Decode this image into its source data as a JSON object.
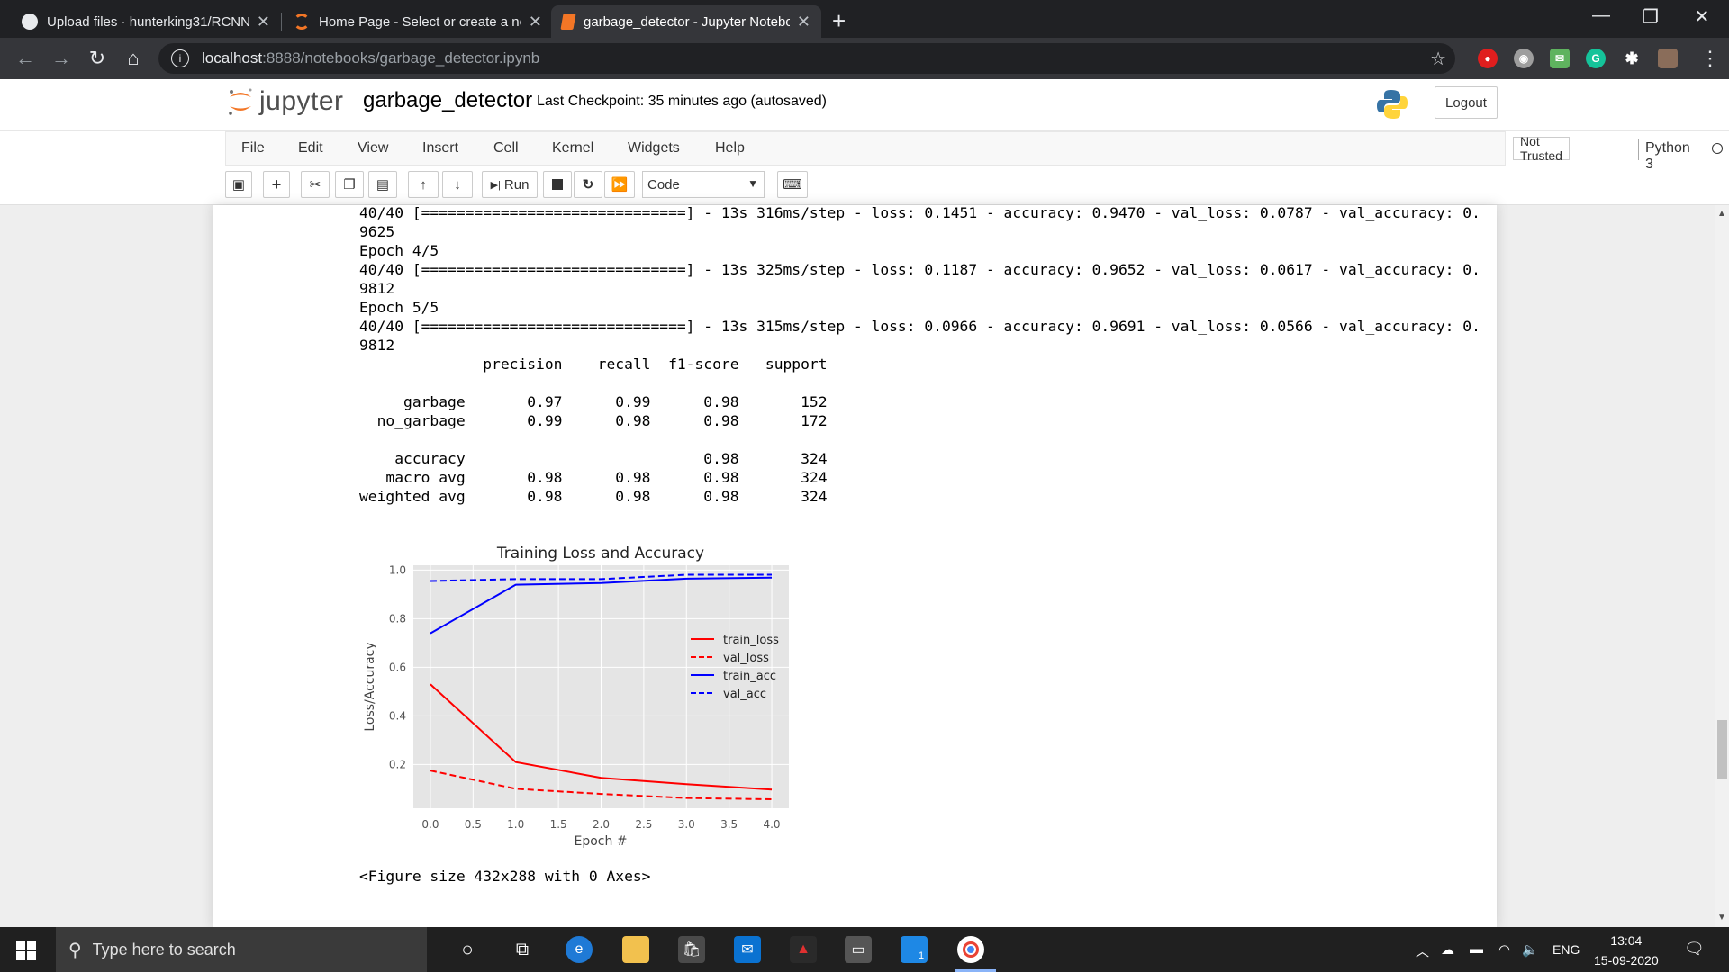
{
  "browser": {
    "tabs": [
      {
        "title": "Upload files · hunterking31/RCNN",
        "icon": "github-icon"
      },
      {
        "title": "Home Page - Select or create a notebook",
        "icon": "jupyter-icon"
      },
      {
        "title": "garbage_detector - Jupyter Notebook",
        "icon": "notebook-icon"
      }
    ],
    "url_host": "localhost",
    "url_rest": ":8888/notebooks/garbage_detector.ipynb"
  },
  "jupyter": {
    "logo_text": "jupyter",
    "notebook_name": "garbage_detector",
    "checkpoint": "Last Checkpoint: 35 minutes ago  (autosaved)",
    "logout_label": "Logout",
    "menu": [
      "File",
      "Edit",
      "View",
      "Insert",
      "Cell",
      "Kernel",
      "Widgets",
      "Help"
    ],
    "trust_label": "Not Trusted",
    "kernel_name": "Python 3",
    "run_label": "Run",
    "cell_type": "Code"
  },
  "output": {
    "lines": [
      "40/40 [==============================] - 13s 316ms/step - loss: 0.1451 - accuracy: 0.9470 - val_loss: 0.0787 - val_accuracy: 0.",
      "9625",
      "Epoch 4/5",
      "40/40 [==============================] - 13s 325ms/step - loss: 0.1187 - accuracy: 0.9652 - val_loss: 0.0617 - val_accuracy: 0.",
      "9812",
      "Epoch 5/5",
      "40/40 [==============================] - 13s 315ms/step - loss: 0.0966 - accuracy: 0.9691 - val_loss: 0.0566 - val_accuracy: 0.",
      "9812",
      "              precision    recall  f1-score   support",
      "",
      "     garbage       0.97      0.99      0.98       152",
      "  no_garbage       0.99      0.98      0.98       172",
      "",
      "    accuracy                           0.98       324",
      "   macro avg       0.98      0.98      0.98       324",
      "weighted avg       0.98      0.98      0.98       324"
    ],
    "figure_caption": "<Figure size 432x288 with 0 Axes>"
  },
  "chart_data": {
    "type": "line",
    "title": "Training Loss and Accuracy",
    "xlabel": "Epoch #",
    "ylabel": "Loss/Accuracy",
    "x": [
      0,
      1,
      2,
      3,
      4
    ],
    "xlim": [
      -0.2,
      4.2
    ],
    "ylim": [
      0.02,
      1.02
    ],
    "xticks": [
      "0.0",
      "0.5",
      "1.0",
      "1.5",
      "2.0",
      "2.5",
      "3.0",
      "3.5",
      "4.0"
    ],
    "yticks": [
      "0.2",
      "0.4",
      "0.6",
      "0.8",
      "1.0"
    ],
    "grid": true,
    "legend": "center-right",
    "series": [
      {
        "name": "train_loss",
        "values": [
          0.53,
          0.21,
          0.145,
          0.119,
          0.097
        ],
        "color": "#ff0000",
        "dash": false
      },
      {
        "name": "val_loss",
        "values": [
          0.175,
          0.1,
          0.079,
          0.062,
          0.057
        ],
        "color": "#ff0000",
        "dash": true
      },
      {
        "name": "train_acc",
        "values": [
          0.74,
          0.94,
          0.947,
          0.965,
          0.969
        ],
        "color": "#0000ff",
        "dash": false
      },
      {
        "name": "val_acc",
        "values": [
          0.955,
          0.963,
          0.963,
          0.981,
          0.981
        ],
        "color": "#0000ff",
        "dash": true
      }
    ]
  },
  "taskbar": {
    "search_placeholder": "Type here to search",
    "language": "ENG",
    "time": "13:04",
    "date": "15-09-2020",
    "notification_count": "1"
  }
}
